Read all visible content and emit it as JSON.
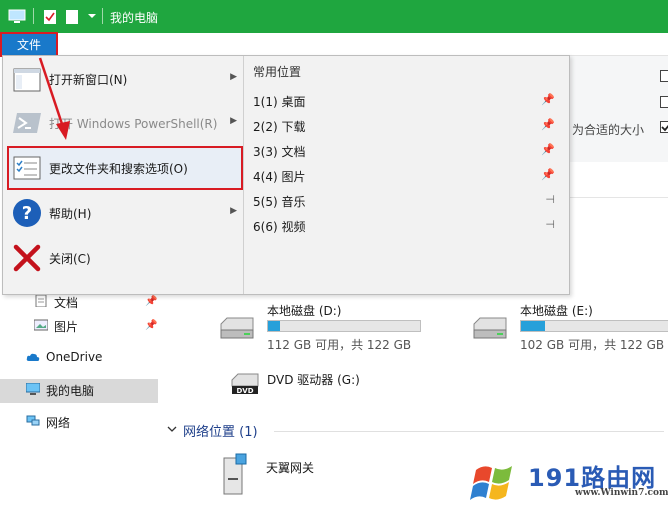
{
  "window": {
    "title": "我的电脑"
  },
  "ribbon": {
    "file_tab": "文件",
    "right_text": "为合适的大小"
  },
  "file_menu": {
    "items": [
      {
        "label": "打开新窗口(N)",
        "has_submenu": true
      },
      {
        "label": "打开 Windows PowerShell(R)",
        "has_submenu": true,
        "disabled": true
      },
      {
        "label": "更改文件夹和搜索选项(O)",
        "has_submenu": false,
        "highlighted": true
      },
      {
        "label": "帮助(H)",
        "has_submenu": true
      },
      {
        "label": "关闭(C)",
        "has_submenu": false
      }
    ],
    "recent_header": "常用位置",
    "recent": [
      {
        "label": "1(1)  桌面",
        "pinned": true
      },
      {
        "label": "2(2)  下载",
        "pinned": true
      },
      {
        "label": "3(3)  文档",
        "pinned": true
      },
      {
        "label": "4(4)  图片",
        "pinned": true
      },
      {
        "label": "5(5)  音乐",
        "pinned": false
      },
      {
        "label": "6(6)  视频",
        "pinned": false
      }
    ]
  },
  "nav": {
    "items": [
      "文档",
      "图片",
      "OneDrive",
      "我的电脑",
      "网络"
    ],
    "selected": "我的电脑"
  },
  "drives": [
    {
      "name": "本地磁盘 (D:)",
      "info": "112 GB 可用，共 122 GB",
      "used_fraction": 0.08
    },
    {
      "name": "本地磁盘 (E:)",
      "info": "102 GB 可用，共 122 GB",
      "used_fraction": 0.16
    },
    {
      "name": "DVD 驱动器 (G:)"
    }
  ],
  "network": {
    "section": "网络位置 (1)",
    "items": [
      "天翼网关"
    ]
  },
  "watermark": {
    "text": "191路由网",
    "url": "www.Winwin7.com"
  },
  "colors": {
    "titlebar": "#1fa63f",
    "file_tab": "#1979ca",
    "annotation": "#d81b23",
    "usage_bar": "#26a0da"
  }
}
